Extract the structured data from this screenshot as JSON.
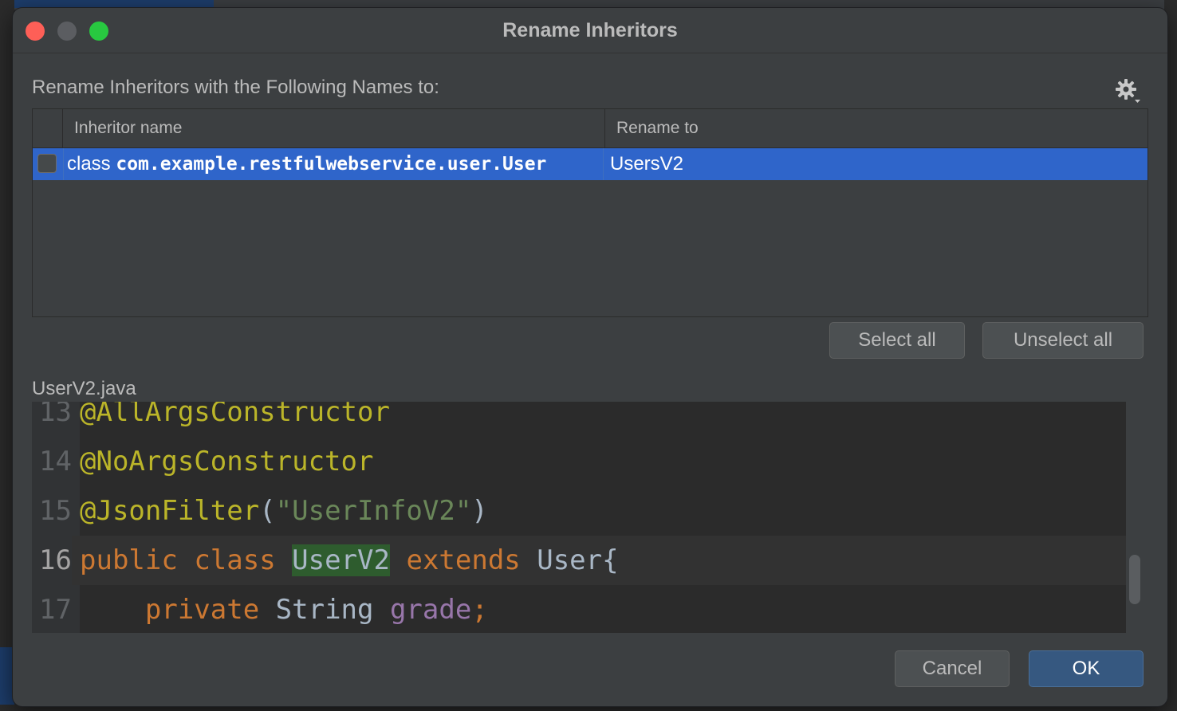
{
  "dialog": {
    "title": "Rename Inheritors",
    "subtitle": "Rename Inheritors with the Following Names to:",
    "settings_icon": "gear-icon"
  },
  "table": {
    "columns": [
      "Inheritor name",
      "Rename to"
    ],
    "rows": [
      {
        "checked": false,
        "kind": "class",
        "name": "com.example.restfulwebservice.user.User",
        "rename_to": "UsersV2",
        "selected": true
      }
    ]
  },
  "buttons": {
    "select_all": "Select all",
    "unselect_all": "Unselect all",
    "cancel": "Cancel",
    "ok": "OK"
  },
  "preview": {
    "filename": "UserV2.java",
    "lines": [
      {
        "number": "13",
        "tokens": [
          {
            "t": "@AllArgsConstructor",
            "c": "ann"
          }
        ]
      },
      {
        "number": "14",
        "tokens": [
          {
            "t": "@NoArgsConstructor",
            "c": "ann"
          }
        ]
      },
      {
        "number": "15",
        "tokens": [
          {
            "t": "@JsonFilter",
            "c": "ann"
          },
          {
            "t": "(",
            "c": "plain"
          },
          {
            "t": "\"UserInfoV2\"",
            "c": "str"
          },
          {
            "t": ")",
            "c": "plain"
          }
        ]
      },
      {
        "number": "16",
        "current": true,
        "tokens": [
          {
            "t": "public",
            "c": "kw"
          },
          {
            "t": " ",
            "c": "plain"
          },
          {
            "t": "class",
            "c": "kw"
          },
          {
            "t": " ",
            "c": "plain"
          },
          {
            "t": "UserV2",
            "c": "hl"
          },
          {
            "t": " ",
            "c": "plain"
          },
          {
            "t": "extends",
            "c": "kw"
          },
          {
            "t": " User{",
            "c": "plain"
          }
        ]
      },
      {
        "number": "17",
        "tokens": [
          {
            "t": "    ",
            "c": "plain"
          },
          {
            "t": "private",
            "c": "kw"
          },
          {
            "t": " String ",
            "c": "plain"
          },
          {
            "t": "grade",
            "c": "fld"
          },
          {
            "t": ";",
            "c": "kw"
          }
        ]
      }
    ]
  },
  "colors": {
    "selection": "#2f65ca",
    "ok_button": "#365880",
    "highlight": "#2e5c2e"
  }
}
